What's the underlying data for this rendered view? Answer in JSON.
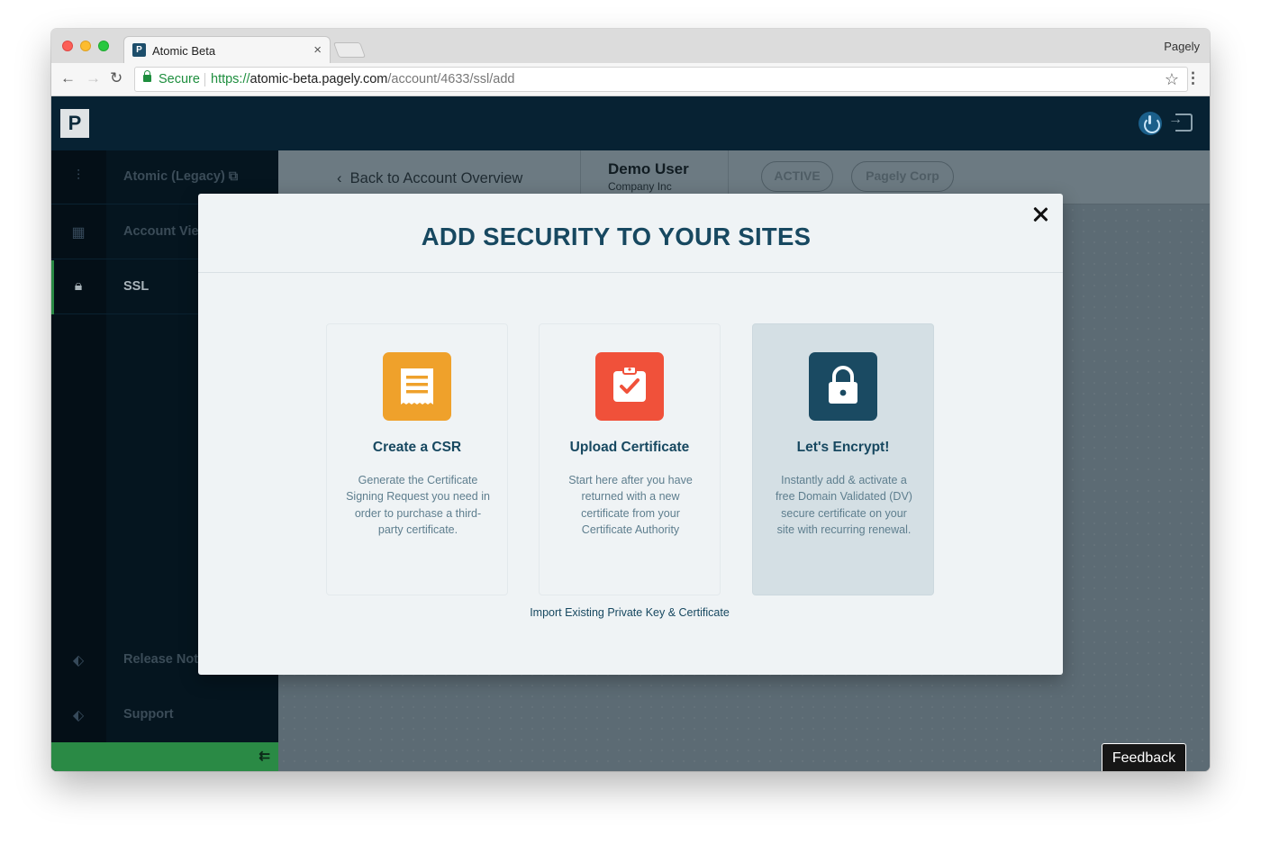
{
  "browser": {
    "tab_title": "Atomic Beta",
    "tab_close": "×",
    "profile_name": "Pagely",
    "secure_label": "Secure",
    "url_scheme": "https://",
    "url_host": "atomic-beta.pagely.com",
    "url_path": "/account/4633/ssl/add",
    "favicon_text": "P",
    "back_glyph": "←",
    "forward_glyph": "→",
    "reload_glyph": "↻",
    "star_glyph": "☆",
    "menu_glyph": "⋮"
  },
  "app": {
    "logo_text": "P",
    "icons": [
      "power-icon",
      "logout-icon"
    ]
  },
  "sidebar": {
    "items": [
      {
        "label": "Atomic (Legacy)",
        "icon": "waveform-icon",
        "glyph": "⫶",
        "suffix_glyph": "⧉"
      },
      {
        "label": "Account View",
        "icon": "dashboard-icon",
        "glyph": "▦"
      },
      {
        "label": "SSL",
        "icon": "lock-icon",
        "glyph": "🔒︎",
        "active": true
      },
      {
        "label": "Release Notes",
        "icon": "tag-icon",
        "glyph": "⬖"
      },
      {
        "label": "Support",
        "icon": "tag-icon",
        "glyph": "⬖"
      }
    ],
    "collapse_glyph": "⇇"
  },
  "header": {
    "back_label": "Back to Account Overview",
    "back_glyph": "‹",
    "user_name": "Demo User",
    "company": "Company Inc",
    "status_pill": "ACTIVE",
    "org_pill": "Pagely Corp"
  },
  "modal": {
    "title": "ADD SECURITY TO YOUR SITES",
    "cards": [
      {
        "title": "Create a CSR",
        "description": "Generate the Certificate Signing Request you need in order to purchase a third-party certificate.",
        "icon": "document-icon",
        "color": "#efa12b"
      },
      {
        "title": "Upload Certificate",
        "description": "Start here after you have returned with a new certificate from your Certificate Authority",
        "icon": "clipboard-check-icon",
        "color": "#f0513a"
      },
      {
        "title": "Let's Encrypt!",
        "description": "Instantly add & activate a free Domain Validated (DV) secure certificate on your site with recurring renewal.",
        "icon": "padlock-icon",
        "color": "#1a4a62",
        "highlighted": true
      }
    ],
    "import_link": "Import Existing Private Key & Certificate"
  },
  "feedback_label": "Feedback",
  "colors": {
    "topbar": "#072233",
    "sidebar": "#05151f",
    "accent_green": "#2a8a45",
    "title_blue": "#174860"
  }
}
